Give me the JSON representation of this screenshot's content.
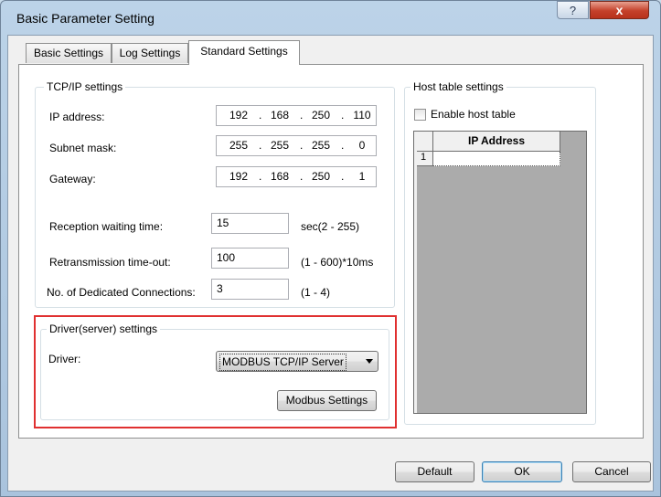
{
  "window": {
    "title": "Basic Parameter Setting",
    "help_glyph": "?",
    "close_glyph": "x"
  },
  "tabs": [
    {
      "label": "Basic Settings",
      "active": false
    },
    {
      "label": "Log Settings",
      "active": false
    },
    {
      "label": "Standard Settings",
      "active": true
    }
  ],
  "tcpip": {
    "legend": "TCP/IP settings",
    "ip_address": {
      "label": "IP address:",
      "octets": [
        "192",
        "168",
        "250",
        "110"
      ]
    },
    "subnet_mask": {
      "label": "Subnet mask:",
      "octets": [
        "255",
        "255",
        "255",
        "0"
      ]
    },
    "gateway": {
      "label": "Gateway:",
      "octets": [
        "192",
        "168",
        "250",
        "1"
      ]
    },
    "reception": {
      "label": "Reception waiting time:",
      "value": "15",
      "unit": "sec(2 - 255)"
    },
    "retransmission": {
      "label": "Retransmission time-out:",
      "value": "100",
      "unit": "(1 - 600)*10ms"
    },
    "dedicated": {
      "label": "No. of Dedicated Connections:",
      "value": "3",
      "unit": "(1 - 4)"
    }
  },
  "driver": {
    "legend": "Driver(server) settings",
    "label": "Driver:",
    "selected": "MODBUS TCP/IP Server",
    "modbus_button": "Modbus Settings",
    "highlight_color": "#e03030"
  },
  "host_table": {
    "legend": "Host table settings",
    "enable_label": "Enable host table",
    "enabled": false,
    "column_header": "IP Address",
    "rows": [
      {
        "index": "1",
        "ip": ""
      }
    ]
  },
  "footer": {
    "default": "Default",
    "ok": "OK",
    "cancel": "Cancel"
  },
  "separator": "."
}
